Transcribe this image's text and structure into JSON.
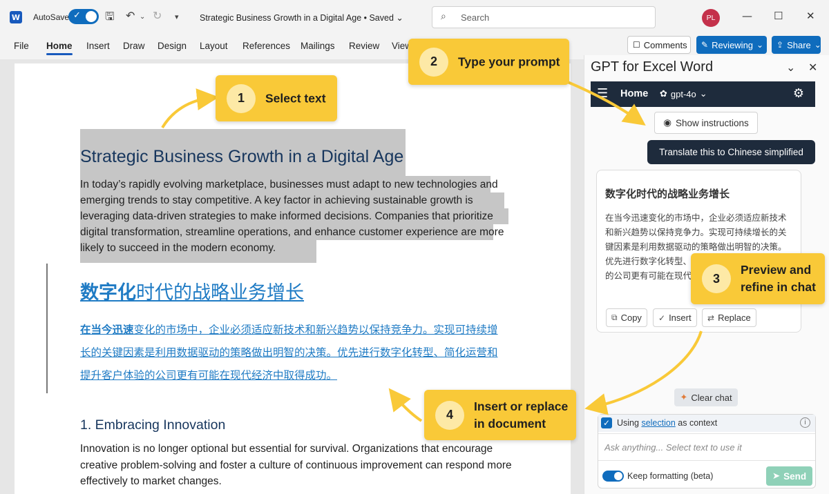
{
  "app": {
    "logo_letter": "W",
    "autosave_label": "AutoSave",
    "doc_title": "Strategic Business Growth in a Digital Age • Saved",
    "search_placeholder": "Search",
    "avatar_initials": "PL"
  },
  "ribbon": {
    "tabs": [
      "File",
      "Home",
      "Insert",
      "Draw",
      "Design",
      "Layout",
      "References",
      "Mailings",
      "Review",
      "View"
    ],
    "comments": "Comments",
    "reviewing": "Reviewing",
    "share": "Share"
  },
  "document": {
    "heading": "Strategic Business Growth in a Digital Age",
    "paragraph": "In today’s rapidly evolving marketplace, businesses must adapt to new technologies and emerging trends to stay competitive. A key factor in achieving sustainable growth is leveraging data-driven strategies to make informed decisions. Companies that prioritize digital transformation, streamline operations, and enhance customer experience are more likely to succeed in the modern economy.",
    "zh_heading_bold": "数字化",
    "zh_heading_rest": "时代的战略业务增长",
    "zh_para_bold": "在当今迅速",
    "zh_para_rest": "变化的市场中，企业必须适应新技术和新兴趋势以保持竞争力。实现可持续增长的关键因素是利用数据驱动的策略做出明智的决策。优先进行数字化转型、简化运营和提升客户体验的公司更有可能在现代经济中取得成功。",
    "section_heading": "1. Embracing Innovation",
    "section_paragraph": "Innovation is no longer optional but essential for survival. Organizations that encourage creative problem-solving and foster a culture of continuous improvement can respond more effectively to market changes."
  },
  "panel": {
    "title": "GPT for Excel Word",
    "nav_home": "Home",
    "model": "gpt-4o",
    "show_instructions": "Show instructions",
    "user_message": "Translate this to Chinese simplified",
    "ai_title": "数字化时代的战略业务增长",
    "ai_body": "在当今迅速变化的市场中，企业必须适应新技术和新兴趋势以保持竞争力。实现可持续增长的关键因素是利用数据驱动的策略做出明智的决策。优先进行数字化转型、简化运营和提升客户体验的公司更有可能在现代经济中取得成功。",
    "copy": "Copy",
    "insert": "Insert",
    "replace": "Replace",
    "clear_chat": "Clear chat",
    "context_pre": "Using",
    "context_link": "selection",
    "context_post": "as context",
    "ask_placeholder": "Ask anything... Select text to use it",
    "keep_formatting": "Keep formatting (beta)",
    "send": "Send"
  },
  "callouts": [
    {
      "num": "1",
      "text": "Select text"
    },
    {
      "num": "2",
      "text": "Type your prompt"
    },
    {
      "num": "3",
      "text": "Preview and refine in chat"
    },
    {
      "num": "4",
      "text": "Insert or replace in document"
    }
  ],
  "colors": {
    "accent": "#0f6cbd",
    "callout": "#f9c938",
    "panel_nav": "#1e2b3c",
    "translated_text": "#1f7bc4",
    "selection": "#c6c6c6"
  }
}
